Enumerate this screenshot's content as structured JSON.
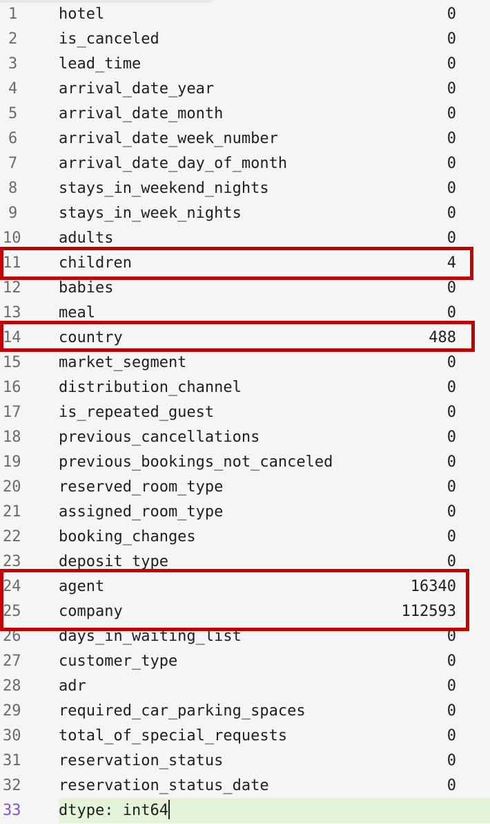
{
  "lines": [
    {
      "num": "1",
      "name": "hotel",
      "value": "0"
    },
    {
      "num": "2",
      "name": "is_canceled",
      "value": "0"
    },
    {
      "num": "3",
      "name": "lead_time",
      "value": "0"
    },
    {
      "num": "4",
      "name": "arrival_date_year",
      "value": "0"
    },
    {
      "num": "5",
      "name": "arrival_date_month",
      "value": "0"
    },
    {
      "num": "6",
      "name": "arrival_date_week_number",
      "value": "0"
    },
    {
      "num": "7",
      "name": "arrival_date_day_of_month",
      "value": "0"
    },
    {
      "num": "8",
      "name": "stays_in_weekend_nights",
      "value": "0"
    },
    {
      "num": "9",
      "name": "stays_in_week_nights",
      "value": "0"
    },
    {
      "num": "10",
      "name": "adults",
      "value": "0"
    },
    {
      "num": "11",
      "name": "children",
      "value": "4"
    },
    {
      "num": "12",
      "name": "babies",
      "value": "0"
    },
    {
      "num": "13",
      "name": "meal",
      "value": "0"
    },
    {
      "num": "14",
      "name": "country",
      "value": "488"
    },
    {
      "num": "15",
      "name": "market_segment",
      "value": "0"
    },
    {
      "num": "16",
      "name": "distribution_channel",
      "value": "0"
    },
    {
      "num": "17",
      "name": "is_repeated_guest",
      "value": "0"
    },
    {
      "num": "18",
      "name": "previous_cancellations",
      "value": "0"
    },
    {
      "num": "19",
      "name": "previous_bookings_not_canceled",
      "value": "0"
    },
    {
      "num": "20",
      "name": "reserved_room_type",
      "value": "0"
    },
    {
      "num": "21",
      "name": "assigned_room_type",
      "value": "0"
    },
    {
      "num": "22",
      "name": "booking_changes",
      "value": "0"
    },
    {
      "num": "23",
      "name": "deposit_type",
      "value": "0"
    },
    {
      "num": "24",
      "name": "agent",
      "value": "16340"
    },
    {
      "num": "25",
      "name": "company",
      "value": "112593"
    },
    {
      "num": "26",
      "name": "days_in_waiting_list",
      "value": "0"
    },
    {
      "num": "27",
      "name": "customer_type",
      "value": "0"
    },
    {
      "num": "28",
      "name": "adr",
      "value": "0"
    },
    {
      "num": "29",
      "name": "required_car_parking_spaces",
      "value": "0"
    },
    {
      "num": "30",
      "name": "total_of_special_requests",
      "value": "0"
    },
    {
      "num": "31",
      "name": "reservation_status",
      "value": "0"
    },
    {
      "num": "32",
      "name": "reservation_status_date",
      "value": "0"
    }
  ],
  "footer": {
    "num": "33",
    "text": "dtype: int64"
  },
  "colors": {
    "highlight": "#c30000",
    "current_line": "#e4f4d9",
    "current_line_number": "#8a4fd6",
    "background": "#f5f5f5"
  }
}
